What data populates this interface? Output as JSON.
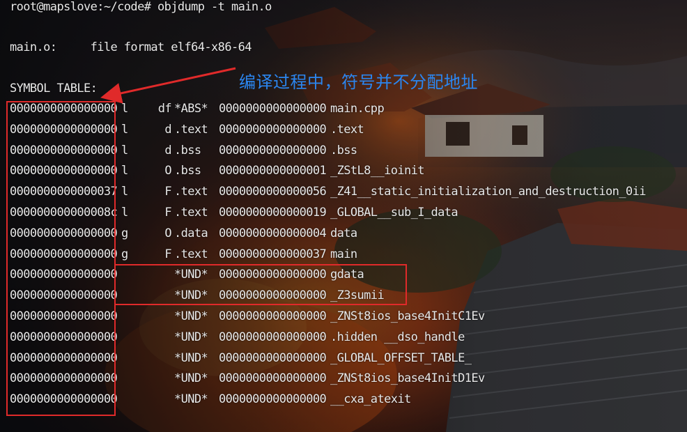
{
  "terminal": {
    "prompt_line": "root@mapslove:~/code# objdump -t main.o",
    "format_line": "main.o:     file format elf64-x86-64",
    "table_header": "SYMBOL TABLE:",
    "rows": [
      {
        "addr": "0000000000000000",
        "scope": "l",
        "flag": "df",
        "section": "*ABS*",
        "size": "0000000000000000",
        "name": "main.cpp"
      },
      {
        "addr": "0000000000000000",
        "scope": "l",
        "flag": "d",
        "section": ".text",
        "size": "0000000000000000",
        "name": ".text"
      },
      {
        "addr": "0000000000000000",
        "scope": "l",
        "flag": "d",
        "section": ".bss",
        "size": "0000000000000000",
        "name": ".bss"
      },
      {
        "addr": "0000000000000000",
        "scope": "l",
        "flag": "O",
        "section": ".bss",
        "size": "0000000000000001",
        "name": "_ZStL8__ioinit"
      },
      {
        "addr": "0000000000000037",
        "scope": "l",
        "flag": "F",
        "section": ".text",
        "size": "0000000000000056",
        "name": "_Z41__static_initialization_and_destruction_0ii"
      },
      {
        "addr": "000000000000008c",
        "scope": "l",
        "flag": "F",
        "section": ".text",
        "size": "0000000000000019",
        "name": "_GLOBAL__sub_I_data"
      },
      {
        "addr": "0000000000000000",
        "scope": "g",
        "flag": "O",
        "section": ".data",
        "size": "0000000000000004",
        "name": "data"
      },
      {
        "addr": "0000000000000000",
        "scope": "g",
        "flag": "F",
        "section": ".text",
        "size": "0000000000000037",
        "name": "main"
      },
      {
        "addr": "0000000000000000",
        "scope": "",
        "flag": "",
        "section": "*UND*",
        "size": "0000000000000000",
        "name": "gdata"
      },
      {
        "addr": "0000000000000000",
        "scope": "",
        "flag": "",
        "section": "*UND*",
        "size": "0000000000000000",
        "name": "_Z3sumii"
      },
      {
        "addr": "0000000000000000",
        "scope": "",
        "flag": "",
        "section": "*UND*",
        "size": "0000000000000000",
        "name": "_ZNSt8ios_base4InitC1Ev"
      },
      {
        "addr": "0000000000000000",
        "scope": "",
        "flag": "",
        "section": "*UND*",
        "size": "0000000000000000",
        "name": ".hidden __dso_handle"
      },
      {
        "addr": "0000000000000000",
        "scope": "",
        "flag": "",
        "section": "*UND*",
        "size": "0000000000000000",
        "name": "_GLOBAL_OFFSET_TABLE_"
      },
      {
        "addr": "0000000000000000",
        "scope": "",
        "flag": "",
        "section": "*UND*",
        "size": "0000000000000000",
        "name": "_ZNSt8ios_base4InitD1Ev"
      },
      {
        "addr": "0000000000000000",
        "scope": "",
        "flag": "",
        "section": "*UND*",
        "size": "0000000000000000",
        "name": "__cxa_atexit"
      }
    ]
  },
  "annotation": {
    "text": "编译过程中，符号并不分配地址",
    "color": "#2b86f0"
  },
  "highlight": {
    "box_color": "#e02a2a"
  }
}
